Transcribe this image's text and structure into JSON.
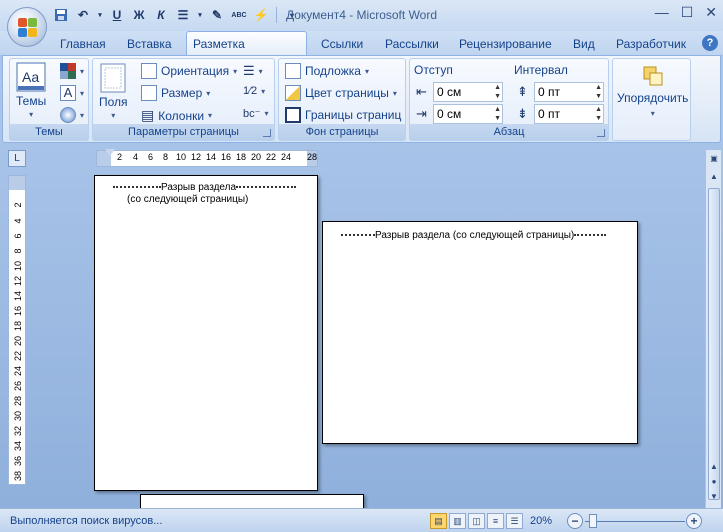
{
  "window": {
    "title": "Документ4 - Microsoft Word",
    "minimize": "—",
    "maximize": "☐",
    "close": "✕"
  },
  "qat": {
    "bold": "Ж",
    "italic": "К",
    "underline": "U",
    "spell": "ABC"
  },
  "tabs": [
    "Главная",
    "Вставка",
    "Разметка страницы",
    "Ссылки",
    "Рассылки",
    "Рецензирование",
    "Вид",
    "Разработчик"
  ],
  "active_tab": "Разметка страницы",
  "help": "?",
  "ribbon": {
    "themes": {
      "group_label": "Темы",
      "button": "Темы"
    },
    "page_setup": {
      "group_label": "Параметры страницы",
      "fields": "Поля",
      "orientation": "Ориентация",
      "size": "Размер",
      "columns": "Колонки"
    },
    "background": {
      "group_label": "Фон страницы",
      "watermark": "Подложка",
      "page_color": "Цвет страницы",
      "page_borders": "Границы страниц"
    },
    "paragraph": {
      "group_label": "Абзац",
      "indent_title": "Отступ",
      "spacing_title": "Интервал",
      "indent_left": "0 см",
      "indent_right": "0 см",
      "spacing_before": "0 пт",
      "spacing_after": "0 пт"
    },
    "arrange": {
      "button": "Упорядочить"
    }
  },
  "ruler": {
    "corner": "L",
    "h_ticks": [
      "2",
      "4",
      "6",
      "8",
      "10",
      "12",
      "14",
      "16",
      "18",
      "20",
      "22",
      "24",
      "28"
    ],
    "v_ticks": [
      "2",
      "4",
      "6",
      "8",
      "10",
      "12",
      "14",
      "16",
      "18",
      "20",
      "22",
      "24",
      "26",
      "28",
      "30",
      "32",
      "34",
      "36",
      "38"
    ]
  },
  "document": {
    "page1_break_line1": "Разрыв раздела",
    "page1_break_line2": "(со следующей страницы)",
    "page2_break": "Разрыв раздела (со следующей страницы)"
  },
  "status": {
    "text": "Выполняется поиск вирусов...",
    "zoom": "20%"
  },
  "colors": {
    "ribbon_text": "#15428b",
    "background": "#a9c4e8",
    "active_view": "#ffd56e"
  }
}
